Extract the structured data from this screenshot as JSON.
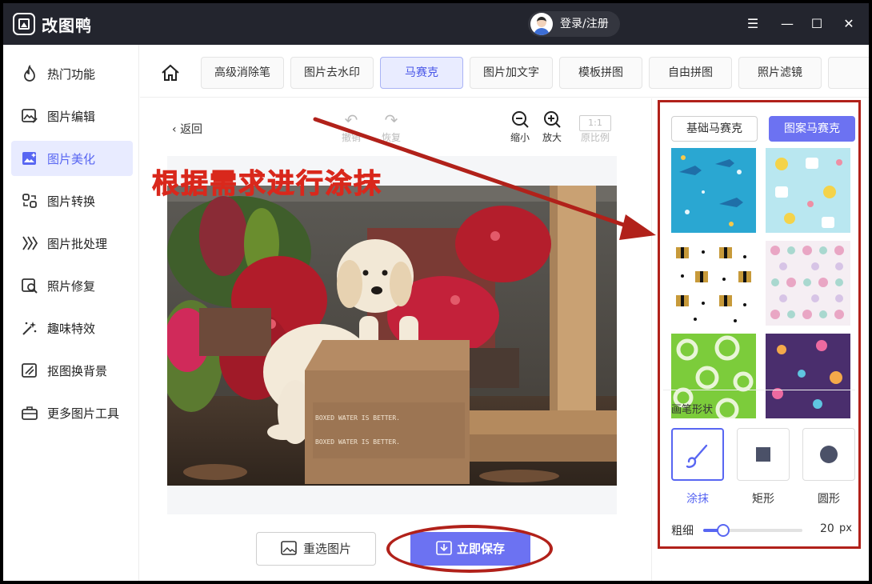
{
  "app": {
    "title": "改图鸭",
    "login_label": "登录/注册"
  },
  "window_controls": [
    {
      "name": "menu-icon",
      "glyph": "☰"
    },
    {
      "name": "minimize-icon",
      "glyph": "—"
    },
    {
      "name": "maximize-icon",
      "glyph": "☐"
    },
    {
      "name": "close-icon",
      "glyph": "✕"
    }
  ],
  "sidebar": {
    "items": [
      {
        "label": "热门功能",
        "icon": "flame-icon"
      },
      {
        "label": "图片编辑",
        "icon": "image-edit-icon"
      },
      {
        "label": "图片美化",
        "icon": "image-beautify-icon",
        "active": true
      },
      {
        "label": "图片转换",
        "icon": "convert-icon"
      },
      {
        "label": "图片批处理",
        "icon": "batch-icon"
      },
      {
        "label": "照片修复",
        "icon": "photo-repair-icon"
      },
      {
        "label": "趣味特效",
        "icon": "sparkle-wand-icon"
      },
      {
        "label": "抠图换背景",
        "icon": "cutout-icon"
      },
      {
        "label": "更多图片工具",
        "icon": "toolbox-icon"
      }
    ]
  },
  "toolbar": {
    "tabs": [
      {
        "label": "高级消除笔"
      },
      {
        "label": "图片去水印"
      },
      {
        "label": "马赛克",
        "active": true
      },
      {
        "label": "图片加文字"
      },
      {
        "label": "模板拼图"
      },
      {
        "label": "自由拼图"
      },
      {
        "label": "照片滤镜"
      }
    ]
  },
  "editor": {
    "back_label": "返回",
    "undo_label": "撤销",
    "redo_label": "恢复",
    "zoom_out_label": "缩小",
    "zoom_in_label": "放大",
    "ratio_glyph": "1:1",
    "ratio_label": "原比例",
    "box_text": "BOXED WATER IS BETTER.",
    "reselect_label": "重选图片",
    "save_label": "立即保存"
  },
  "annotation": {
    "heading": "根据需求进行涂抹",
    "color": "#d9281c"
  },
  "mosaic_panel": {
    "basic_label": "基础马赛克",
    "pattern_label": "图案马赛克",
    "patterns": [
      {
        "name": "shark-pattern",
        "bg": "#2aa7d2"
      },
      {
        "name": "baby-items-pattern",
        "bg": "#b9e7f0"
      },
      {
        "name": "gift-star-pattern",
        "bg": "#ffffff"
      },
      {
        "name": "pastel-dots-pattern",
        "bg": "#f5eef3"
      },
      {
        "name": "green-rings-pattern",
        "bg": "#7ccc3b"
      },
      {
        "name": "purple-dots-pattern",
        "bg": "#4a2e6d"
      }
    ],
    "brush_title": "画笔形状",
    "brushes": [
      {
        "label": "涂抹",
        "icon": "brush-icon",
        "active": true
      },
      {
        "label": "矩形",
        "icon": "square-icon"
      },
      {
        "label": "圆形",
        "icon": "circle-icon"
      }
    ],
    "size_label": "粗细",
    "size_value": "20",
    "size_unit": "px",
    "size_fraction": 0.2
  },
  "colors": {
    "accent": "#5866f2",
    "save_button": "#6c72f2",
    "titlebar": "#23252e",
    "annotation_red": "#b1211a"
  }
}
